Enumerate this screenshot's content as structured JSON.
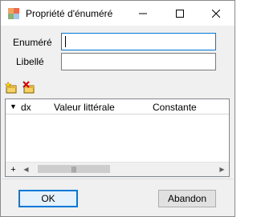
{
  "window": {
    "title": "Propriété d'énuméré",
    "controls": {
      "minimize": "minimize-icon",
      "maximize": "maximize-icon",
      "close": "close-icon"
    }
  },
  "form": {
    "enumere_label": "Enuméré",
    "enumere_value": "",
    "libelle_label": "Libellé",
    "libelle_value": ""
  },
  "toolbar": {
    "add_icon": "add-row-icon",
    "delete_icon": "delete-row-icon"
  },
  "grid": {
    "columns": [
      "dx",
      "Valeur littérale",
      "Constante"
    ],
    "sort_indicator": "▼",
    "rows": [],
    "scroll_add_glyph": "+",
    "scroll_thumb_glyph": "|||"
  },
  "buttons": {
    "ok": "OK",
    "cancel": "Abandon"
  },
  "colors": {
    "accent": "#0078d7",
    "window_bg": "#f0f0f0"
  }
}
